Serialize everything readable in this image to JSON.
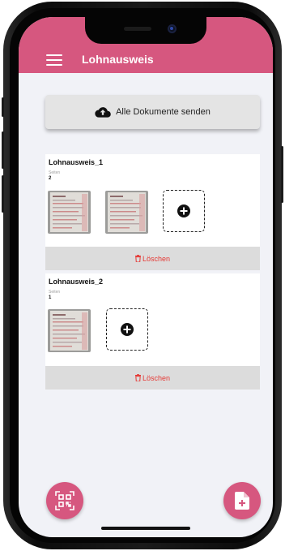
{
  "app_bar": {
    "title": "Lohnausweis",
    "color": "#d6577f"
  },
  "send_button": {
    "label": "Alle Dokumente senden",
    "icon": "cloud-upload-icon"
  },
  "documents": [
    {
      "title": "Lohnausweis_1",
      "pages_label": "Seiten",
      "pages_count": "2",
      "delete_label": "Löschen"
    },
    {
      "title": "Lohnausweis_2",
      "pages_label": "Seiten",
      "pages_count": "1",
      "delete_label": "Löschen"
    }
  ],
  "fabs": {
    "left_icon": "qr-scan-icon",
    "right_icon": "add-document-icon"
  },
  "colors": {
    "accent": "#d6577f",
    "delete": "#e53935",
    "background": "#f1f2f7"
  }
}
